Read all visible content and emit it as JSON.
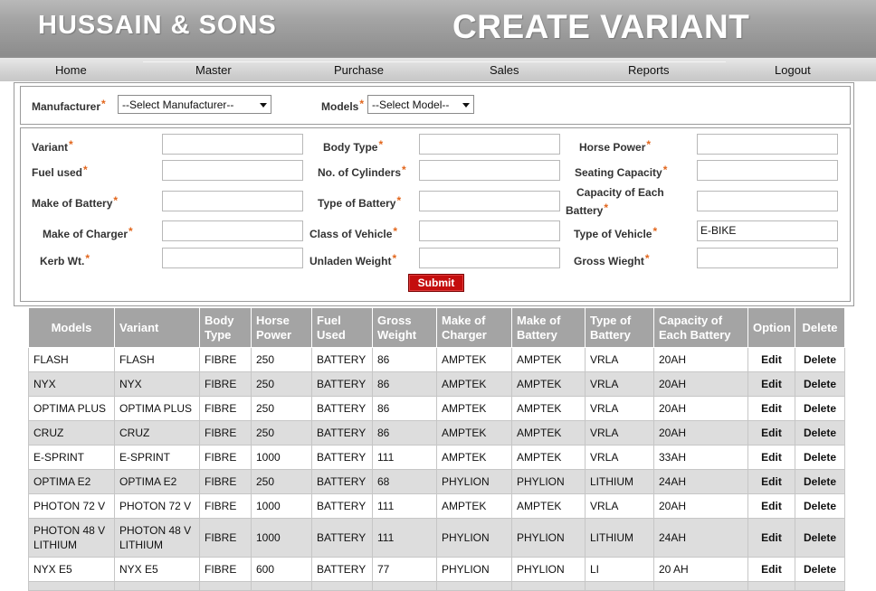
{
  "header": {
    "company": "HUSSAIN & SONS",
    "title": "CREATE VARIANT"
  },
  "nav": [
    "Home",
    "Master",
    "Purchase",
    "Sales",
    "Reports",
    "Logout"
  ],
  "selectors": {
    "manufacturer_label": "Manufacturer",
    "manufacturer_value": "--Select Manufacturer--",
    "models_label": "Models",
    "models_value": "--Select Model--"
  },
  "fields": {
    "variant": {
      "label": "Variant",
      "value": ""
    },
    "body_type": {
      "label": "Body Type",
      "value": ""
    },
    "horse_power": {
      "label": "Horse Power",
      "value": ""
    },
    "fuel_used": {
      "label": "Fuel used",
      "value": ""
    },
    "no_of_cylinders": {
      "label": "No. of Cylinders",
      "value": ""
    },
    "seating_capacity": {
      "label": "Seating Capacity",
      "value": ""
    },
    "make_of_battery": {
      "label": "Make of Battery",
      "value": ""
    },
    "type_of_battery": {
      "label": "Type of Battery",
      "value": ""
    },
    "capacity_line1": "Capacity of Each",
    "capacity_line2": "Battery",
    "capacity_value": "",
    "make_of_charger": {
      "label": "Make of Charger",
      "value": ""
    },
    "class_of_vehicle": {
      "label": "Class of Vehicle",
      "value": ""
    },
    "type_of_vehicle": {
      "label": "Type of Vehicle",
      "value": "E-BIKE"
    },
    "kerb_wt": {
      "label": "Kerb Wt.",
      "value": ""
    },
    "unladen_weight": {
      "label": "Unladen Weight",
      "value": ""
    },
    "gross_weight": {
      "label": "Gross Wieght",
      "value": ""
    },
    "required_mark": "*"
  },
  "submit_label": "Submit",
  "table": {
    "headers": [
      "Models",
      "Variant",
      "Body Type",
      "Horse Power",
      "Fuel Used",
      "Gross Weight",
      "Make of Charger",
      "Make of Battery",
      "Type of Battery",
      "Capacity of Each Battery",
      "Option",
      "Delete"
    ],
    "rows": [
      [
        "FLASH",
        "FLASH",
        "FIBRE",
        "250",
        "BATTERY",
        "86",
        "AMPTEK",
        "AMPTEK",
        "VRLA",
        "20AH",
        "Edit",
        "Delete"
      ],
      [
        "NYX",
        "NYX",
        "FIBRE",
        "250",
        "BATTERY",
        "86",
        "AMPTEK",
        "AMPTEK",
        "VRLA",
        "20AH",
        "Edit",
        "Delete"
      ],
      [
        "OPTIMA PLUS",
        "OPTIMA PLUS",
        "FIBRE",
        "250",
        "BATTERY",
        "86",
        "AMPTEK",
        "AMPTEK",
        "VRLA",
        "20AH",
        "Edit",
        "Delete"
      ],
      [
        "CRUZ",
        "CRUZ",
        "FIBRE",
        "250",
        "BATTERY",
        "86",
        "AMPTEK",
        "AMPTEK",
        "VRLA",
        "20AH",
        "Edit",
        "Delete"
      ],
      [
        "E-SPRINT",
        "E-SPRINT",
        "FIBRE",
        "1000",
        "BATTERY",
        "111",
        "AMPTEK",
        "AMPTEK",
        "VRLA",
        "33AH",
        "Edit",
        "Delete"
      ],
      [
        "OPTIMA E2",
        "OPTIMA E2",
        "FIBRE",
        "250",
        "BATTERY",
        "68",
        "PHYLION",
        "PHYLION",
        "LITHIUM",
        "24AH",
        "Edit",
        "Delete"
      ],
      [
        "PHOTON 72 V",
        "PHOTON 72 V",
        "FIBRE",
        "1000",
        "BATTERY",
        "111",
        "AMPTEK",
        "AMPTEK",
        "VRLA",
        "20AH",
        "Edit",
        "Delete"
      ],
      [
        "PHOTON 48 V LITHIUM",
        "PHOTON 48 V LITHIUM",
        "FIBRE",
        "1000",
        "BATTERY",
        "111",
        "PHYLION",
        "PHYLION",
        "LITHIUM",
        "24AH",
        "Edit",
        "Delete"
      ],
      [
        "NYX E5",
        "NYX E5",
        "FIBRE",
        "600",
        "BATTERY",
        "77",
        "PHYLION",
        "PHYLION",
        "LI",
        "20 AH",
        "Edit",
        "Delete"
      ]
    ]
  }
}
